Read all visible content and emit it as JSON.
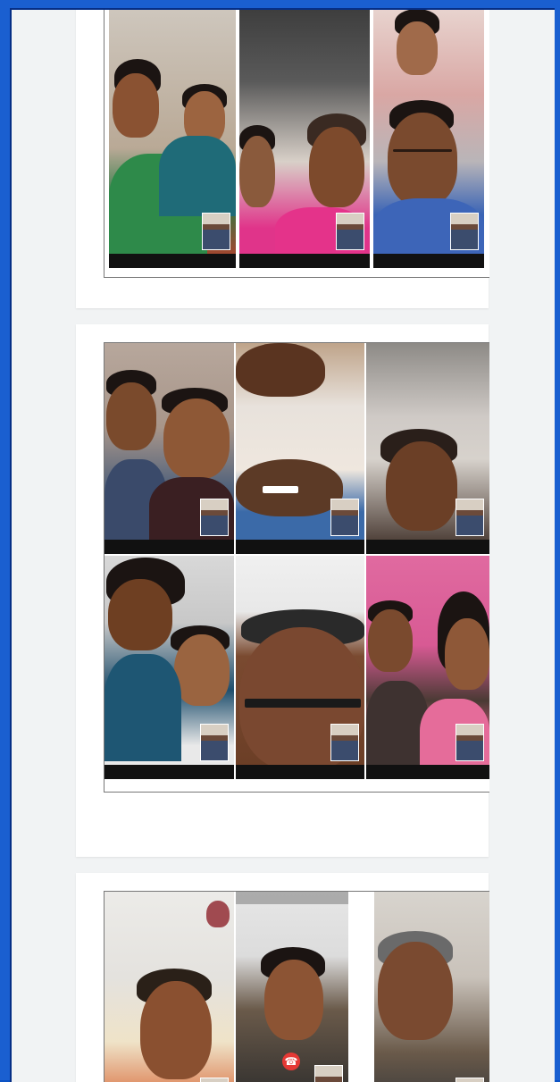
{
  "page": {
    "description_free": true
  },
  "colors": {
    "frame": "#1a5fd0",
    "background": "#f1f3f4",
    "card": "#ffffff",
    "end_call": "#e53935"
  },
  "cards": [
    {
      "tiles": 3,
      "rows": 1
    },
    {
      "tiles": 6,
      "rows": 2
    },
    {
      "tiles": 3,
      "rows": 1
    }
  ],
  "icons": {
    "end_call": "phone-hangup-icon",
    "nav_back": "nav-back-icon",
    "nav_home": "nav-home-icon",
    "nav_recent": "nav-recent-icon"
  },
  "end_call_glyph": "☎"
}
